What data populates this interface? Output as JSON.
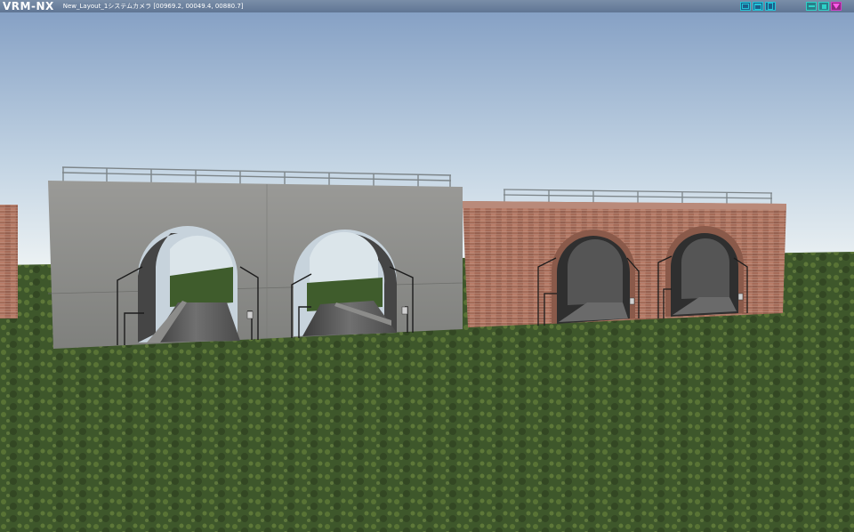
{
  "app": {
    "logo": "VRM-NX"
  },
  "viewport": {
    "layout_name": "New_Layout_1",
    "camera": "システムカメラ",
    "coordinates": "[00969.2, 00049.4, 00880.7]"
  },
  "window_controls": {
    "view_buttons": [
      "view-mode-1-icon",
      "view-mode-2-icon",
      "view-mode-3-icon"
    ],
    "system_buttons": [
      "minimize-icon",
      "restore-icon",
      "menu-triangle-icon"
    ]
  },
  "colors": {
    "titlebar": "#6b809e",
    "view_button": "#22c4d8",
    "system_button": "#2fd2c8",
    "menu_button": "#d23ec8",
    "sky_top": "#87a2c6",
    "sky_horizon": "#eaf1f4",
    "grass": "#3f5a2c",
    "concrete": "#8f8f8c",
    "brick": "#a66a57"
  }
}
